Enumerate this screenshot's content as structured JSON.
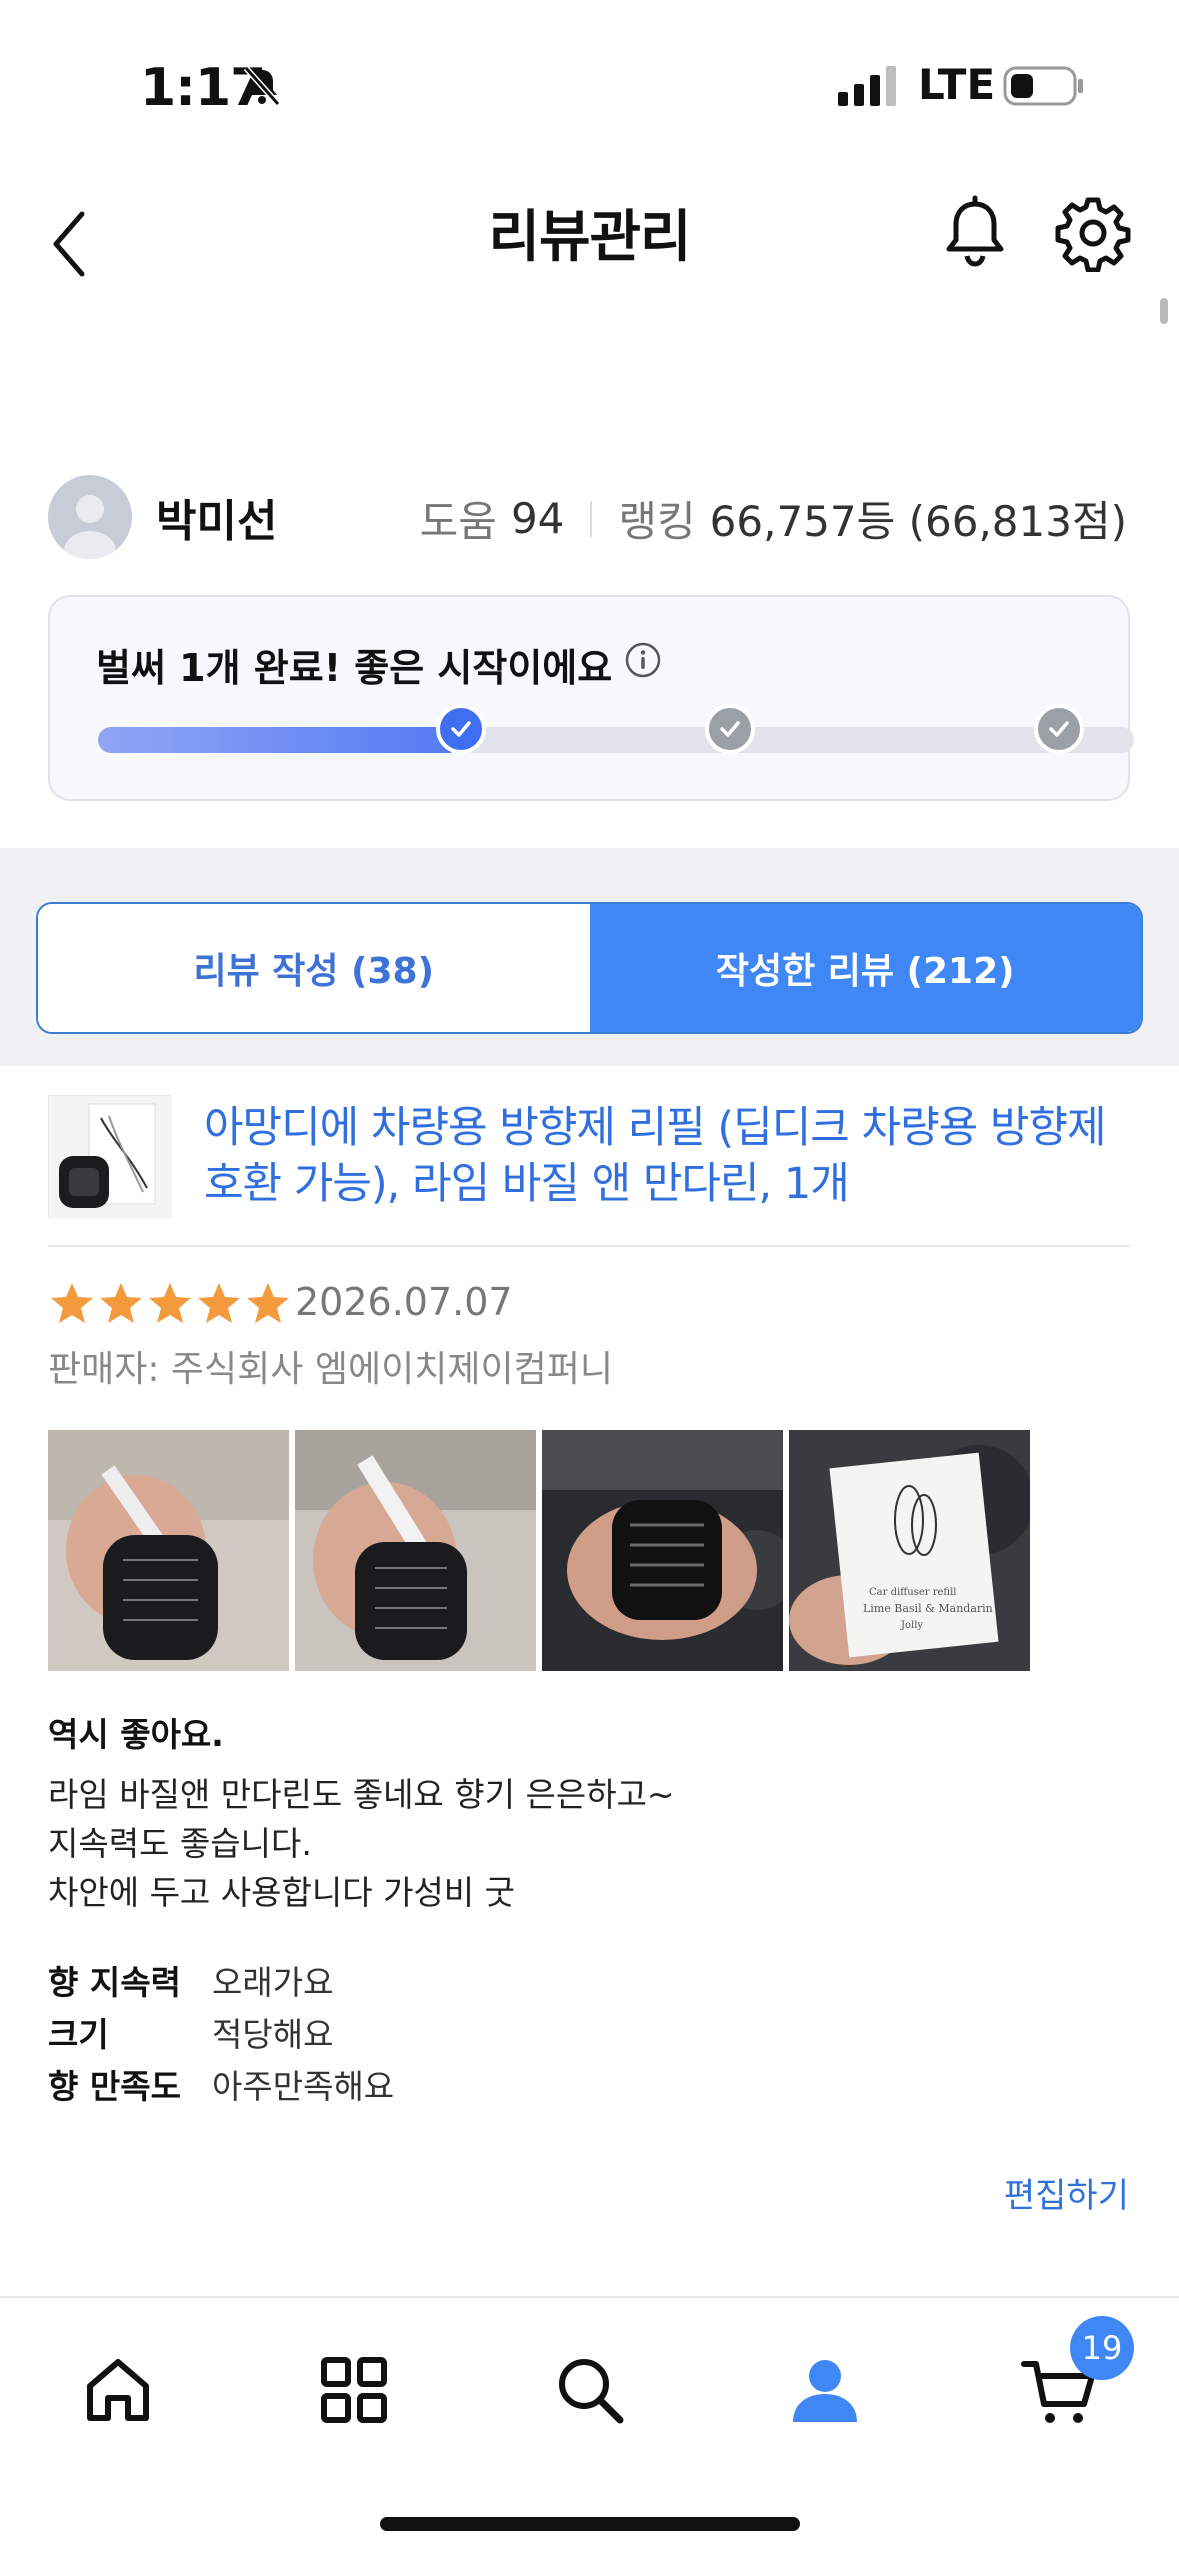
{
  "status_bar": {
    "time": "1:17",
    "network": "LTE"
  },
  "header": {
    "title": "리뷰관리"
  },
  "profile": {
    "name": "박미선",
    "help_label": "도움",
    "help_value": "94",
    "rank_label": "랭킹",
    "rank_value": "66,757등 (66,813점)"
  },
  "progress": {
    "title": "벌써 1개 완료! 좋은 시작이에요",
    "fraction": 0.35
  },
  "tabs": [
    {
      "label": "리뷰 작성 (38)",
      "active": false
    },
    {
      "label": "작성한 리뷰 (212)",
      "active": true
    }
  ],
  "review": {
    "product_line1": "아망디에 차량용 방향제 리필 (딥디크 차량용 방향제",
    "product_line2": "호환 가능), 라임 바질 앤 만다린, 1개",
    "rating": 5,
    "date": "2026.07.07",
    "seller": "판매자: 주식회사 엠에이치제이컴퍼니",
    "photo_card_text": {
      "line1": "Car diffuser refill",
      "line2": "Lime Basil & Mandarin",
      "line3": "Jolly"
    },
    "headline": "역시 좋아요.",
    "body": [
      "라임 바질앤 만다린도 좋네요 향기 은은하고~",
      "지속력도 좋습니다.",
      "차안에 두고 사용합니다 가성비 굿"
    ],
    "attributes": [
      {
        "key": "향 지속력",
        "value": "오래가요"
      },
      {
        "key": "크기",
        "value": "적당해요"
      },
      {
        "key": "향 만족도",
        "value": "아주만족해요"
      }
    ],
    "edit_label": "편집하기"
  },
  "bottom_nav": {
    "items": [
      "home-icon",
      "categories-icon",
      "search-icon",
      "profile-icon",
      "cart-icon"
    ],
    "cart_badge": "19",
    "active_color": "#3f87f5"
  }
}
